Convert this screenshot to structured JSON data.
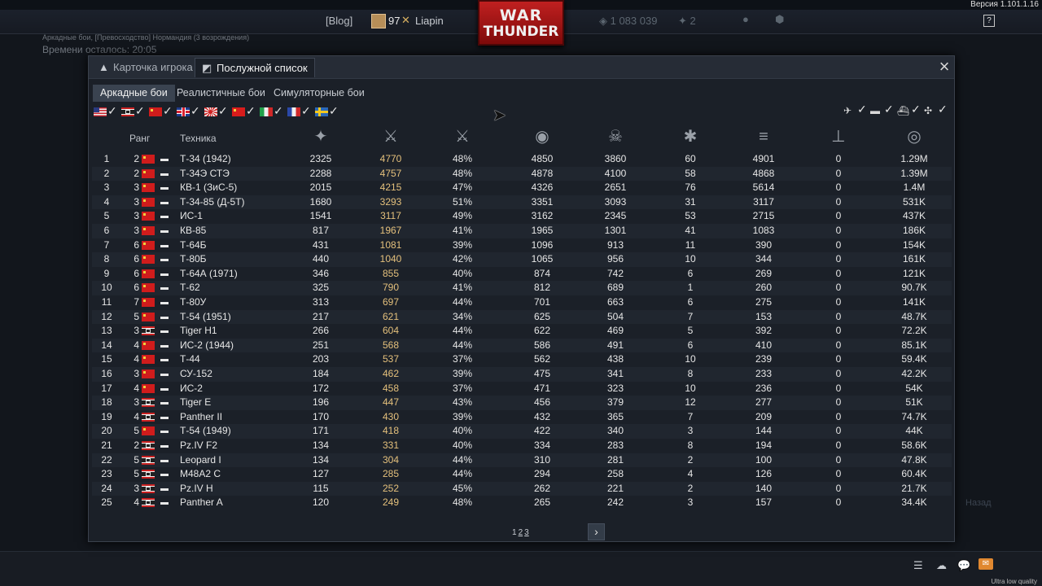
{
  "version": "Версия 1.101.1.16",
  "top": {
    "blog": "[Blog]",
    "player_level": "97",
    "player_name": "Liapin",
    "logo_line1": "WAR",
    "logo_line2": "THUNDER",
    "silver": "1 083 039",
    "eagles": "2"
  },
  "battle": {
    "info": "Аркадные бои, [Превосходство] Нормандия (3 возрождения)",
    "timer": "Времени осталось: 20:05"
  },
  "background": {
    "back_label": "Назад"
  },
  "bottom": {
    "ultra": "Ultra low quality"
  },
  "modal": {
    "tabs": [
      {
        "label": "Карточка игрока",
        "icon": "user-card-icon"
      },
      {
        "label": "Послужной список",
        "icon": "service-record-icon"
      }
    ],
    "mode_tabs": [
      "Аркадные бои",
      "Реалистичные бои",
      "Симуляторные бои"
    ],
    "nations": [
      "usa",
      "germany",
      "ussr",
      "uk",
      "japan",
      "china",
      "italy",
      "france",
      "sweden"
    ],
    "unit_types": [
      "aircraft-icon",
      "tank-icon",
      "ship-icon",
      "helicopter-icon"
    ],
    "columns": {
      "rank": "Ранг",
      "vehicle": "Техника",
      "icons": [
        "battles-icon",
        "victories-icon",
        "win-rate-icon",
        "ground-kills-icon",
        "deaths-icon",
        "stars-icon",
        "naval-kills-icon",
        "fleet-icon",
        "experience-icon"
      ]
    },
    "pager": {
      "current": "1",
      "pages": [
        "2",
        "3"
      ]
    }
  },
  "rows": [
    {
      "n": "1",
      "rank": "2",
      "nation": "ussr",
      "name": "Т-34 (1942)",
      "battles": "2325",
      "kills": "4770",
      "winrate": "48%",
      "ground": "4850",
      "deaths": "3860",
      "stars": "60",
      "naval": "4901",
      "fleet": "0",
      "exp": "1.29M"
    },
    {
      "n": "2",
      "rank": "2",
      "nation": "ussr",
      "name": "Т-34Э СТЭ",
      "battles": "2288",
      "kills": "4757",
      "winrate": "48%",
      "ground": "4878",
      "deaths": "4100",
      "stars": "58",
      "naval": "4868",
      "fleet": "0",
      "exp": "1.39M"
    },
    {
      "n": "3",
      "rank": "3",
      "nation": "ussr",
      "name": "КВ-1 (ЗиС-5)",
      "battles": "2015",
      "kills": "4215",
      "winrate": "47%",
      "ground": "4326",
      "deaths": "2651",
      "stars": "76",
      "naval": "5614",
      "fleet": "0",
      "exp": "1.4M"
    },
    {
      "n": "4",
      "rank": "3",
      "nation": "ussr",
      "name": "Т-34-85 (Д-5Т)",
      "battles": "1680",
      "kills": "3293",
      "winrate": "51%",
      "ground": "3351",
      "deaths": "3093",
      "stars": "31",
      "naval": "3117",
      "fleet": "0",
      "exp": "531K"
    },
    {
      "n": "5",
      "rank": "3",
      "nation": "ussr",
      "name": "ИС-1",
      "battles": "1541",
      "kills": "3117",
      "winrate": "49%",
      "ground": "3162",
      "deaths": "2345",
      "stars": "53",
      "naval": "2715",
      "fleet": "0",
      "exp": "437K"
    },
    {
      "n": "6",
      "rank": "3",
      "nation": "ussr",
      "name": "КВ-85",
      "battles": "817",
      "kills": "1967",
      "winrate": "41%",
      "ground": "1965",
      "deaths": "1301",
      "stars": "41",
      "naval": "1083",
      "fleet": "0",
      "exp": "186K"
    },
    {
      "n": "7",
      "rank": "6",
      "nation": "ussr",
      "name": "Т-64Б",
      "battles": "431",
      "kills": "1081",
      "winrate": "39%",
      "ground": "1096",
      "deaths": "913",
      "stars": "11",
      "naval": "390",
      "fleet": "0",
      "exp": "154K"
    },
    {
      "n": "8",
      "rank": "6",
      "nation": "ussr",
      "name": "Т-80Б",
      "battles": "440",
      "kills": "1040",
      "winrate": "42%",
      "ground": "1065",
      "deaths": "956",
      "stars": "10",
      "naval": "344",
      "fleet": "0",
      "exp": "161K"
    },
    {
      "n": "9",
      "rank": "6",
      "nation": "ussr",
      "name": "Т-64А (1971)",
      "battles": "346",
      "kills": "855",
      "winrate": "40%",
      "ground": "874",
      "deaths": "742",
      "stars": "6",
      "naval": "269",
      "fleet": "0",
      "exp": "121K"
    },
    {
      "n": "10",
      "rank": "6",
      "nation": "ussr",
      "name": "Т-62",
      "battles": "325",
      "kills": "790",
      "winrate": "41%",
      "ground": "812",
      "deaths": "689",
      "stars": "1",
      "naval": "260",
      "fleet": "0",
      "exp": "90.7K"
    },
    {
      "n": "11",
      "rank": "7",
      "nation": "ussr",
      "name": "Т-80У",
      "battles": "313",
      "kills": "697",
      "winrate": "44%",
      "ground": "701",
      "deaths": "663",
      "stars": "6",
      "naval": "275",
      "fleet": "0",
      "exp": "141K"
    },
    {
      "n": "12",
      "rank": "5",
      "nation": "ussr",
      "name": "Т-54 (1951)",
      "battles": "217",
      "kills": "621",
      "winrate": "34%",
      "ground": "625",
      "deaths": "504",
      "stars": "7",
      "naval": "153",
      "fleet": "0",
      "exp": "48.7K"
    },
    {
      "n": "13",
      "rank": "3",
      "nation": "germany",
      "name": "Tiger H1",
      "battles": "266",
      "kills": "604",
      "winrate": "44%",
      "ground": "622",
      "deaths": "469",
      "stars": "5",
      "naval": "392",
      "fleet": "0",
      "exp": "72.2K"
    },
    {
      "n": "14",
      "rank": "4",
      "nation": "ussr",
      "name": "ИС-2 (1944)",
      "battles": "251",
      "kills": "568",
      "winrate": "44%",
      "ground": "586",
      "deaths": "491",
      "stars": "6",
      "naval": "410",
      "fleet": "0",
      "exp": "85.1K"
    },
    {
      "n": "15",
      "rank": "4",
      "nation": "ussr",
      "name": "Т-44",
      "battles": "203",
      "kills": "537",
      "winrate": "37%",
      "ground": "562",
      "deaths": "438",
      "stars": "10",
      "naval": "239",
      "fleet": "0",
      "exp": "59.4K"
    },
    {
      "n": "16",
      "rank": "3",
      "nation": "ussr",
      "name": "СУ-152",
      "battles": "184",
      "kills": "462",
      "winrate": "39%",
      "ground": "475",
      "deaths": "341",
      "stars": "8",
      "naval": "233",
      "fleet": "0",
      "exp": "42.2K"
    },
    {
      "n": "17",
      "rank": "4",
      "nation": "ussr",
      "name": "ИС-2",
      "battles": "172",
      "kills": "458",
      "winrate": "37%",
      "ground": "471",
      "deaths": "323",
      "stars": "10",
      "naval": "236",
      "fleet": "0",
      "exp": "54K"
    },
    {
      "n": "18",
      "rank": "3",
      "nation": "germany",
      "name": "Tiger E",
      "battles": "196",
      "kills": "447",
      "winrate": "43%",
      "ground": "456",
      "deaths": "379",
      "stars": "12",
      "naval": "277",
      "fleet": "0",
      "exp": "51K"
    },
    {
      "n": "19",
      "rank": "4",
      "nation": "germany",
      "name": "Panther II",
      "battles": "170",
      "kills": "430",
      "winrate": "39%",
      "ground": "432",
      "deaths": "365",
      "stars": "7",
      "naval": "209",
      "fleet": "0",
      "exp": "74.7K"
    },
    {
      "n": "20",
      "rank": "5",
      "nation": "ussr",
      "name": "Т-54 (1949)",
      "battles": "171",
      "kills": "418",
      "winrate": "40%",
      "ground": "422",
      "deaths": "340",
      "stars": "3",
      "naval": "144",
      "fleet": "0",
      "exp": "44K"
    },
    {
      "n": "21",
      "rank": "2",
      "nation": "germany",
      "name": "Pz.IV F2",
      "battles": "134",
      "kills": "331",
      "winrate": "40%",
      "ground": "334",
      "deaths": "283",
      "stars": "8",
      "naval": "194",
      "fleet": "0",
      "exp": "58.6K"
    },
    {
      "n": "22",
      "rank": "5",
      "nation": "germany",
      "name": "Leopard I",
      "battles": "134",
      "kills": "304",
      "winrate": "44%",
      "ground": "310",
      "deaths": "281",
      "stars": "2",
      "naval": "100",
      "fleet": "0",
      "exp": "47.8K"
    },
    {
      "n": "23",
      "rank": "5",
      "nation": "germany",
      "name": "M48A2 C",
      "battles": "127",
      "kills": "285",
      "winrate": "44%",
      "ground": "294",
      "deaths": "258",
      "stars": "4",
      "naval": "126",
      "fleet": "0",
      "exp": "60.4K"
    },
    {
      "n": "24",
      "rank": "3",
      "nation": "germany",
      "name": "Pz.IV H",
      "battles": "115",
      "kills": "252",
      "winrate": "45%",
      "ground": "262",
      "deaths": "221",
      "stars": "2",
      "naval": "140",
      "fleet": "0",
      "exp": "21.7K"
    },
    {
      "n": "25",
      "rank": "4",
      "nation": "germany",
      "name": "Panther A",
      "battles": "120",
      "kills": "249",
      "winrate": "48%",
      "ground": "265",
      "deaths": "242",
      "stars": "3",
      "naval": "157",
      "fleet": "0",
      "exp": "34.4K"
    }
  ]
}
